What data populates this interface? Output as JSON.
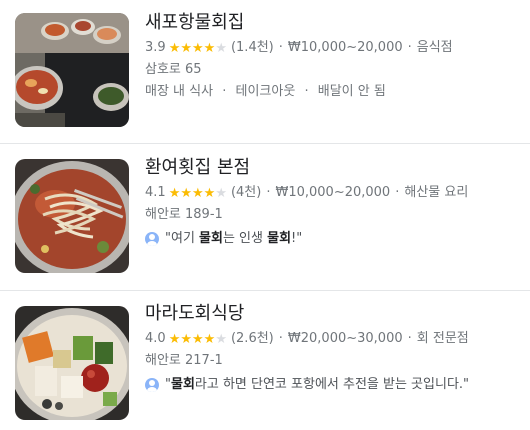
{
  "results": [
    {
      "name": "새포항물회집",
      "rating": "3.9",
      "stars": 4,
      "reviews": "(1.4천)",
      "price": "₩10,000~20,000",
      "category": "음식점",
      "address": "삼호로 65",
      "services": [
        "매장 내 식사",
        "테이크아웃",
        "배달이 안 됨"
      ],
      "photo": "food-photo-icon"
    },
    {
      "name": "환여횟집 본점",
      "rating": "4.1",
      "stars": 4,
      "reviews": "(4천)",
      "price": "₩10,000~20,000",
      "category": "해산물 요리",
      "address": "해안로 189-1",
      "review_parts": [
        "\"여기 ",
        "물회",
        "는 인생 ",
        "물회",
        "!\""
      ],
      "photo": "noodle-photo-icon"
    },
    {
      "name": "마라도회식당",
      "rating": "4.0",
      "stars": 4,
      "reviews": "(2.6천)",
      "price": "₩20,000~30,000",
      "category": "회 전문점",
      "address": "해안로 217-1",
      "review_parts": [
        "\"",
        "물회",
        "라고 하면 단연코 포항에서 추전을 받는 곳입니다.\""
      ],
      "photo": "raw-fish-bowl-photo-icon"
    }
  ],
  "separator_dot": "·",
  "star_glyph": "★",
  "colors": {
    "star_on": "#fbbc04",
    "star_off": "#dadce0",
    "muted": "#70757a",
    "title": "#202124"
  }
}
